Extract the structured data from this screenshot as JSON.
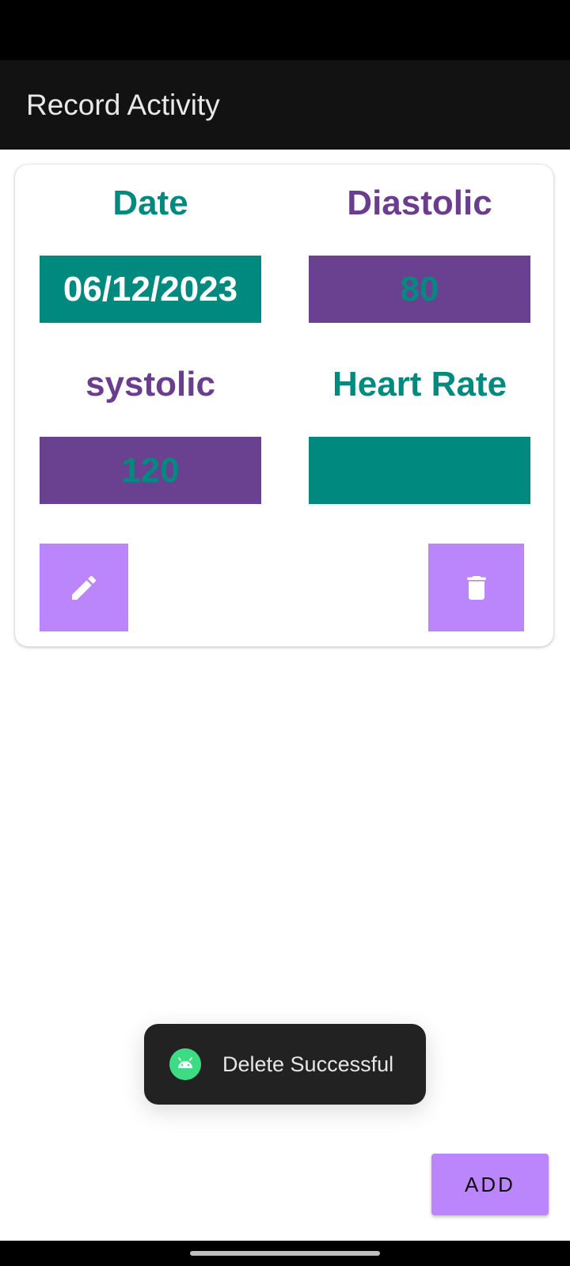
{
  "app_bar": {
    "title": "Record Activity"
  },
  "record": {
    "date_label": "Date",
    "date_value": "06/12/2023",
    "diastolic_label": "Diastolic",
    "diastolic_value": "80",
    "systolic_label": "systolic",
    "systolic_value": "120",
    "heart_rate_label": "Heart Rate",
    "heart_rate_value": ""
  },
  "actions": {
    "edit_icon": "pencil-icon",
    "delete_icon": "trash-icon"
  },
  "toast": {
    "message": "Delete Successful",
    "icon": "android-icon"
  },
  "add_button": {
    "label": "ADD"
  },
  "colors": {
    "teal": "#00897f",
    "purple": "#6a4190",
    "accent": "#bb86fc",
    "app_bar": "#121212"
  }
}
